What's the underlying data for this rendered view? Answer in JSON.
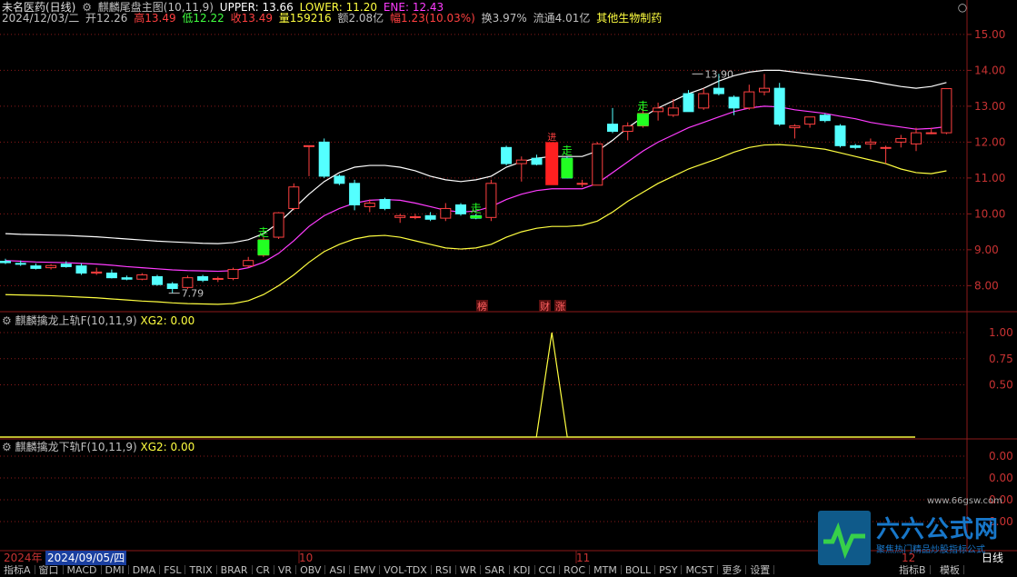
{
  "header": {
    "stock_name": "未名医药(日线)",
    "indicator_title": "麒麟尾盘主图(10,11,9)",
    "upper": "UPPER: 13.66",
    "lower": "LOWER: 11.20",
    "ene": "ENE: 12.43",
    "date": "2024/12/03/二",
    "open": "开12.26",
    "high": "高13.49",
    "low": "低12.22",
    "close": "收13.49",
    "volume": "量159216",
    "amount": "额2.08亿",
    "change": "幅1.23(10.03%)",
    "turnover": "换3.97%",
    "float_cap": "流通4.01亿",
    "sector": "其他生物制药"
  },
  "sub1": {
    "title": "麒麟擒龙上轨F(10,11,9)",
    "value": "XG2: 0.00"
  },
  "sub2": {
    "title": "麒麟擒龙下轨F(10,11,9)",
    "value": "XG2: 0.00"
  },
  "price_axis": [
    "15.00",
    "14.00",
    "13.00",
    "12.00",
    "11.00",
    "10.00",
    "9.00",
    "8.00"
  ],
  "sub1_axis": [
    "1.00",
    "0.75",
    "0.50"
  ],
  "sub2_axis": [
    "0.00",
    "0.00",
    "0.00",
    "0.00"
  ],
  "annotations": {
    "high_label": "13.90",
    "low_label": "7.79",
    "signal": "走",
    "signal_alt": "进",
    "event_bang": "榜",
    "event_cai": "财",
    "event_zhang": "涨"
  },
  "date_bar": {
    "year": "2024年",
    "cursor_date": "2024/09/05/四",
    "month_10": "10",
    "month_11": "11",
    "month_12": "12",
    "period": "日线"
  },
  "tabs": [
    "指标A",
    "窗口",
    "MACD",
    "DMI",
    "DMA",
    "FSL",
    "TRIX",
    "BRAR",
    "CR",
    "VR",
    "OBV",
    "ASI",
    "EMV",
    "VOL-TDX",
    "RSI",
    "WR",
    "SAR",
    "KDJ",
    "CCI",
    "ROC",
    "MTM",
    "BOLL",
    "PSY",
    "MCST",
    "更多",
    "设置"
  ],
  "right_tabs": [
    "指标B",
    "模板"
  ],
  "watermark": {
    "brand": "六六公式网",
    "url": "www.66gsw.com",
    "slogan": "聚焦热门精品炒股指标公式"
  },
  "colors": {
    "up": "#ff4040",
    "down": "#54ffff",
    "upper": "#ffffff",
    "mid": "#ff3cff",
    "lower": "#ffff40",
    "grid": "#8b1a1a",
    "signal_green": "#22ff22",
    "signal_red": "#ff2020",
    "indicator": "#ffff40"
  },
  "chart_data": {
    "type": "candlestick",
    "title": "麒麟尾盘主图(10,11,9)",
    "ylim": [
      7.3,
      15.2
    ],
    "candles": [
      {
        "o": 8.68,
        "h": 8.75,
        "l": 8.6,
        "c": 8.64
      },
      {
        "o": 8.62,
        "h": 8.7,
        "l": 8.55,
        "c": 8.6
      },
      {
        "o": 8.55,
        "h": 8.62,
        "l": 8.45,
        "c": 8.48
      },
      {
        "o": 8.5,
        "h": 8.6,
        "l": 8.45,
        "c": 8.56
      },
      {
        "o": 8.6,
        "h": 8.68,
        "l": 8.5,
        "c": 8.53
      },
      {
        "o": 8.55,
        "h": 8.62,
        "l": 8.3,
        "c": 8.35
      },
      {
        "o": 8.35,
        "h": 8.5,
        "l": 8.3,
        "c": 8.38
      },
      {
        "o": 8.35,
        "h": 8.45,
        "l": 8.2,
        "c": 8.22
      },
      {
        "o": 8.22,
        "h": 8.28,
        "l": 8.15,
        "c": 8.18
      },
      {
        "o": 8.18,
        "h": 8.35,
        "l": 8.15,
        "c": 8.3
      },
      {
        "o": 8.25,
        "h": 8.3,
        "l": 8.0,
        "c": 8.03
      },
      {
        "o": 8.05,
        "h": 8.1,
        "l": 7.79,
        "c": 7.92
      },
      {
        "o": 7.95,
        "h": 8.28,
        "l": 7.9,
        "c": 8.22
      },
      {
        "o": 8.25,
        "h": 8.3,
        "l": 8.1,
        "c": 8.15
      },
      {
        "o": 8.18,
        "h": 8.25,
        "l": 8.1,
        "c": 8.2
      },
      {
        "o": 8.2,
        "h": 8.5,
        "l": 8.15,
        "c": 8.45
      },
      {
        "o": 8.55,
        "h": 8.8,
        "l": 8.5,
        "c": 8.7
      },
      {
        "o": 8.85,
        "h": 9.35,
        "l": 8.8,
        "c": 9.28
      },
      {
        "o": 9.35,
        "h": 10.05,
        "l": 9.3,
        "c": 10.03
      },
      {
        "o": 10.15,
        "h": 10.85,
        "l": 10.1,
        "c": 10.75
      },
      {
        "o": 11.9,
        "h": 11.9,
        "l": 11.05,
        "c": 11.9
      },
      {
        "o": 12.0,
        "h": 12.1,
        "l": 11.0,
        "c": 11.05
      },
      {
        "o": 11.05,
        "h": 11.1,
        "l": 10.8,
        "c": 10.85
      },
      {
        "o": 10.85,
        "h": 10.95,
        "l": 10.1,
        "c": 10.25
      },
      {
        "o": 10.2,
        "h": 10.4,
        "l": 10.05,
        "c": 10.3
      },
      {
        "o": 10.4,
        "h": 10.45,
        "l": 10.1,
        "c": 10.15
      },
      {
        "o": 9.9,
        "h": 10.0,
        "l": 9.75,
        "c": 9.95
      },
      {
        "o": 9.9,
        "h": 10.0,
        "l": 9.85,
        "c": 9.92
      },
      {
        "o": 9.95,
        "h": 10.05,
        "l": 9.8,
        "c": 9.85
      },
      {
        "o": 9.88,
        "h": 10.3,
        "l": 9.8,
        "c": 10.15
      },
      {
        "o": 10.25,
        "h": 10.3,
        "l": 9.95,
        "c": 10.0
      },
      {
        "o": 9.95,
        "h": 10.0,
        "l": 9.85,
        "c": 9.88
      },
      {
        "o": 9.9,
        "h": 10.95,
        "l": 9.8,
        "c": 10.85
      },
      {
        "o": 11.85,
        "h": 11.9,
        "l": 11.35,
        "c": 11.4
      },
      {
        "o": 11.4,
        "h": 11.6,
        "l": 10.9,
        "c": 11.5
      },
      {
        "o": 11.55,
        "h": 11.65,
        "l": 11.35,
        "c": 11.38
      },
      {
        "o": 11.4,
        "h": 11.5,
        "l": 11.3,
        "c": 11.42
      },
      {
        "o": 11.55,
        "h": 11.6,
        "l": 11.0,
        "c": 11.0
      },
      {
        "o": 10.85,
        "h": 10.95,
        "l": 10.75,
        "c": 10.85
      },
      {
        "o": 10.8,
        "h": 12.0,
        "l": 10.8,
        "c": 11.95
      },
      {
        "o": 12.5,
        "h": 12.95,
        "l": 12.25,
        "c": 12.3
      },
      {
        "o": 12.3,
        "h": 12.55,
        "l": 12.05,
        "c": 12.45
      },
      {
        "o": 12.45,
        "h": 12.95,
        "l": 12.4,
        "c": 12.8
      },
      {
        "o": 12.85,
        "h": 13.1,
        "l": 12.6,
        "c": 12.95
      },
      {
        "o": 12.75,
        "h": 13.2,
        "l": 12.7,
        "c": 12.95
      },
      {
        "o": 13.35,
        "h": 13.45,
        "l": 12.85,
        "c": 12.85
      },
      {
        "o": 12.95,
        "h": 13.5,
        "l": 12.9,
        "c": 13.35
      },
      {
        "o": 13.5,
        "h": 13.9,
        "l": 13.3,
        "c": 13.35
      },
      {
        "o": 13.25,
        "h": 13.3,
        "l": 12.75,
        "c": 12.95
      },
      {
        "o": 12.95,
        "h": 13.6,
        "l": 12.9,
        "c": 13.4
      },
      {
        "o": 13.4,
        "h": 13.9,
        "l": 13.3,
        "c": 13.5
      },
      {
        "o": 13.5,
        "h": 13.65,
        "l": 12.45,
        "c": 12.5
      },
      {
        "o": 12.4,
        "h": 12.5,
        "l": 12.1,
        "c": 12.45
      },
      {
        "o": 12.5,
        "h": 12.7,
        "l": 12.4,
        "c": 12.7
      },
      {
        "o": 12.75,
        "h": 12.8,
        "l": 12.55,
        "c": 12.6
      },
      {
        "o": 12.45,
        "h": 12.5,
        "l": 11.85,
        "c": 11.9
      },
      {
        "o": 11.9,
        "h": 11.95,
        "l": 11.8,
        "c": 11.85
      },
      {
        "o": 11.95,
        "h": 12.1,
        "l": 11.8,
        "c": 12.0
      },
      {
        "o": 11.85,
        "h": 11.9,
        "l": 11.4,
        "c": 11.85
      },
      {
        "o": 12.0,
        "h": 12.2,
        "l": 11.85,
        "c": 12.1
      },
      {
        "o": 11.95,
        "h": 12.4,
        "l": 11.75,
        "c": 12.26
      },
      {
        "o": 12.26,
        "h": 12.4,
        "l": 12.22,
        "c": 12.26
      },
      {
        "o": 12.26,
        "h": 13.49,
        "l": 12.22,
        "c": 13.49
      }
    ],
    "upper": [
      9.45,
      9.43,
      9.42,
      9.41,
      9.4,
      9.38,
      9.36,
      9.33,
      9.3,
      9.27,
      9.24,
      9.22,
      9.2,
      9.18,
      9.17,
      9.2,
      9.28,
      9.45,
      9.75,
      10.15,
      10.55,
      10.9,
      11.15,
      11.3,
      11.35,
      11.35,
      11.3,
      11.2,
      11.05,
      10.95,
      10.9,
      10.95,
      11.05,
      11.3,
      11.45,
      11.55,
      11.6,
      11.6,
      11.6,
      11.75,
      12.05,
      12.4,
      12.7,
      12.95,
      13.15,
      13.35,
      13.5,
      13.7,
      13.85,
      13.95,
      14.0,
      14.0,
      13.95,
      13.9,
      13.85,
      13.8,
      13.75,
      13.7,
      13.62,
      13.55,
      13.5,
      13.55,
      13.66
    ],
    "mid": [
      8.7,
      8.68,
      8.66,
      8.65,
      8.64,
      8.62,
      8.6,
      8.57,
      8.53,
      8.5,
      8.47,
      8.44,
      8.42,
      8.41,
      8.4,
      8.42,
      8.5,
      8.65,
      8.9,
      9.25,
      9.65,
      9.95,
      10.15,
      10.3,
      10.38,
      10.4,
      10.38,
      10.3,
      10.2,
      10.1,
      10.05,
      10.08,
      10.2,
      10.4,
      10.55,
      10.65,
      10.7,
      10.7,
      10.7,
      10.85,
      11.15,
      11.45,
      11.75,
      12.0,
      12.2,
      12.4,
      12.55,
      12.7,
      12.85,
      12.95,
      13.0,
      12.98,
      12.9,
      12.85,
      12.8,
      12.72,
      12.65,
      12.55,
      12.48,
      12.42,
      12.36,
      12.38,
      12.43
    ],
    "lower": [
      7.75,
      7.74,
      7.73,
      7.72,
      7.7,
      7.68,
      7.66,
      7.63,
      7.6,
      7.57,
      7.55,
      7.52,
      7.5,
      7.49,
      7.48,
      7.5,
      7.58,
      7.75,
      8.0,
      8.3,
      8.65,
      8.95,
      9.15,
      9.3,
      9.38,
      9.4,
      9.35,
      9.25,
      9.15,
      9.05,
      9.02,
      9.05,
      9.15,
      9.35,
      9.5,
      9.6,
      9.65,
      9.65,
      9.68,
      9.8,
      10.05,
      10.35,
      10.6,
      10.85,
      11.05,
      11.25,
      11.4,
      11.55,
      11.72,
      11.85,
      11.92,
      11.93,
      11.9,
      11.85,
      11.8,
      11.7,
      11.6,
      11.5,
      11.4,
      11.25,
      11.15,
      11.12,
      11.2
    ],
    "xg2_sub1": {
      "spike_index": 36,
      "value": 1.0
    },
    "xg2_sub2": {
      "value": 0.0
    }
  }
}
